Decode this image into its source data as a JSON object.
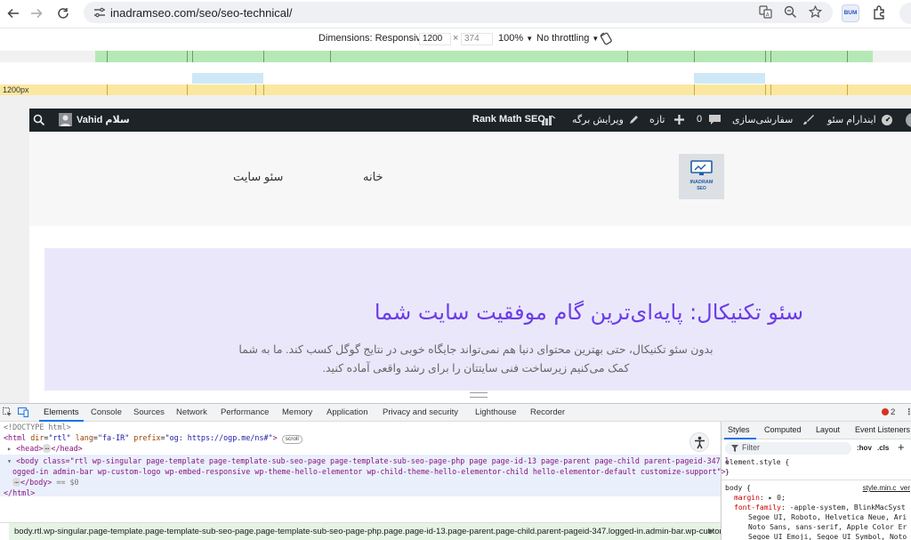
{
  "browser": {
    "url": "inadramseo.com/seo/seo-technical/",
    "extension_badge": "BUM"
  },
  "device_toolbar": {
    "dimensions_label": "Dimensions: Responsive",
    "width": "1200",
    "times": "×",
    "height": "374",
    "zoom": "100%",
    "throttling": "No throttling",
    "ruler_label": "1200px"
  },
  "admin_bar": {
    "account": "سلام Vahid",
    "rank_math": "Rank Math SEO",
    "edit_page": "ویرایش برگه",
    "new": "تازه",
    "comments": "0",
    "customize": "سفارشی‌سازی",
    "site_name": "ایندارام سئو"
  },
  "site_header": {
    "nav_home": "خانه",
    "nav_seo": "سئو سایت",
    "logo_text": "INADRAM",
    "logo_sub": "SEO"
  },
  "hero": {
    "title": "سئو تکنیکال: پایه‌ای‌ترین گام موفقیت سایت شما",
    "line1": "بدون سئو تکنیکال، حتی بهترین محتوای دنیا هم نمی‌تواند جایگاه خوبی در نتایج گوگل کسب کند. ما به شما",
    "line2": "کمک می‌کنیم زیرساخت فنی سایتتان را برای رشد واقعی آماده کنید."
  },
  "devtools": {
    "tabs": [
      "Elements",
      "Console",
      "Sources",
      "Network",
      "Performance",
      "Memory",
      "Application",
      "Privacy and security",
      "Lighthouse",
      "Recorder"
    ],
    "error_count": "2",
    "dom": {
      "doctype": "<!DOCTYPE html>",
      "html_tag": "html",
      "html_attrs": [
        {
          "name": "dir",
          "value": "\"rtl\""
        },
        {
          "name": "lang",
          "value": "\"fa-IR\""
        },
        {
          "name": "prefix",
          "value": "\"og: https://ogp.me/ns#\""
        }
      ],
      "scroll_badge": "scroll",
      "head_open": "<head>",
      "head_close": "</head>",
      "body_line1": "<body class=\"rtl wp-singular page-template page-template-sub-seo-page page-template-sub-seo-page-php page page-id-13 page-parent page-child parent-pageid-347 l",
      "body_line2": "ogged-in admin-bar wp-custom-logo wp-embed-responsive wp-theme-hello-elementor wp-child-theme-hello-elementor-child hello-elementor-default customize-support\">",
      "body_close": "</body>",
      "dollar": "== $0",
      "html_close": "</html>"
    },
    "breadcrumb": "body.rtl.wp-singular.page-template.page-template-sub-seo-page.page-template-sub-seo-page-php.page.page-id-13.page-parent.page-child.parent-pageid-347.logged-in.admin-bar.wp-custom",
    "styles_tabs": [
      "Styles",
      "Computed",
      "Layout",
      "Event Listeners"
    ],
    "filter_placeholder": "Filter",
    "hov": ":hov",
    "cls": ".cls",
    "element_style": "element.style {",
    "brace_close": "}",
    "body_selector": "body {",
    "source_file": "style.min.c_ver",
    "margin_prop": "margin",
    "margin_val": "▸ 0;",
    "font_prop": "font-family",
    "font_val_1": "-apple-system, BlinkMacSyst",
    "font_val_2": "Segoe UI, Roboto, Helvetica Neue, Ari",
    "font_val_3": "Noto Sans, sans-serif, Apple Color Er",
    "font_val_4": "Segoe UI Emoji, Segoe UI Symbol, Noto"
  },
  "colors": {
    "admin_bg": "#1d2327",
    "hero_bg": "#ebe7fb",
    "hero_title": "#6a3de8",
    "mq_green": "#b6e8b6",
    "mq_blue": "#cfe8f7",
    "mq_yellow": "#fbe7a0"
  }
}
